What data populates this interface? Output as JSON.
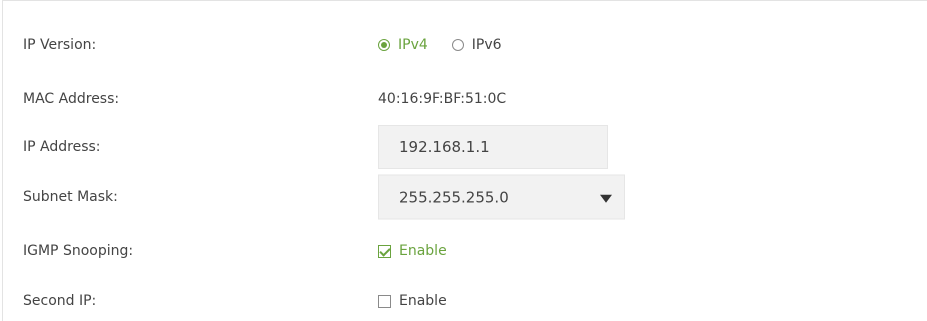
{
  "fields": {
    "ip_version": {
      "label": "IP Version:",
      "options": [
        "IPv4",
        "IPv6"
      ],
      "selected": "IPv4"
    },
    "mac_address": {
      "label": "MAC Address:",
      "value": "40:16:9F:BF:51:0C"
    },
    "ip_address": {
      "label": "IP Address:",
      "value": "192.168.1.1"
    },
    "subnet_mask": {
      "label": "Subnet Mask:",
      "value": "255.255.255.0"
    },
    "igmp_snooping": {
      "label": "IGMP Snooping:",
      "checkbox_label": "Enable",
      "checked": true
    },
    "second_ip": {
      "label": "Second IP:",
      "checkbox_label": "Enable",
      "checked": false
    }
  },
  "colors": {
    "accent": "#6aa33e",
    "text": "#444444",
    "field_bg": "#f2f2f2",
    "border": "#e3e3e3"
  }
}
